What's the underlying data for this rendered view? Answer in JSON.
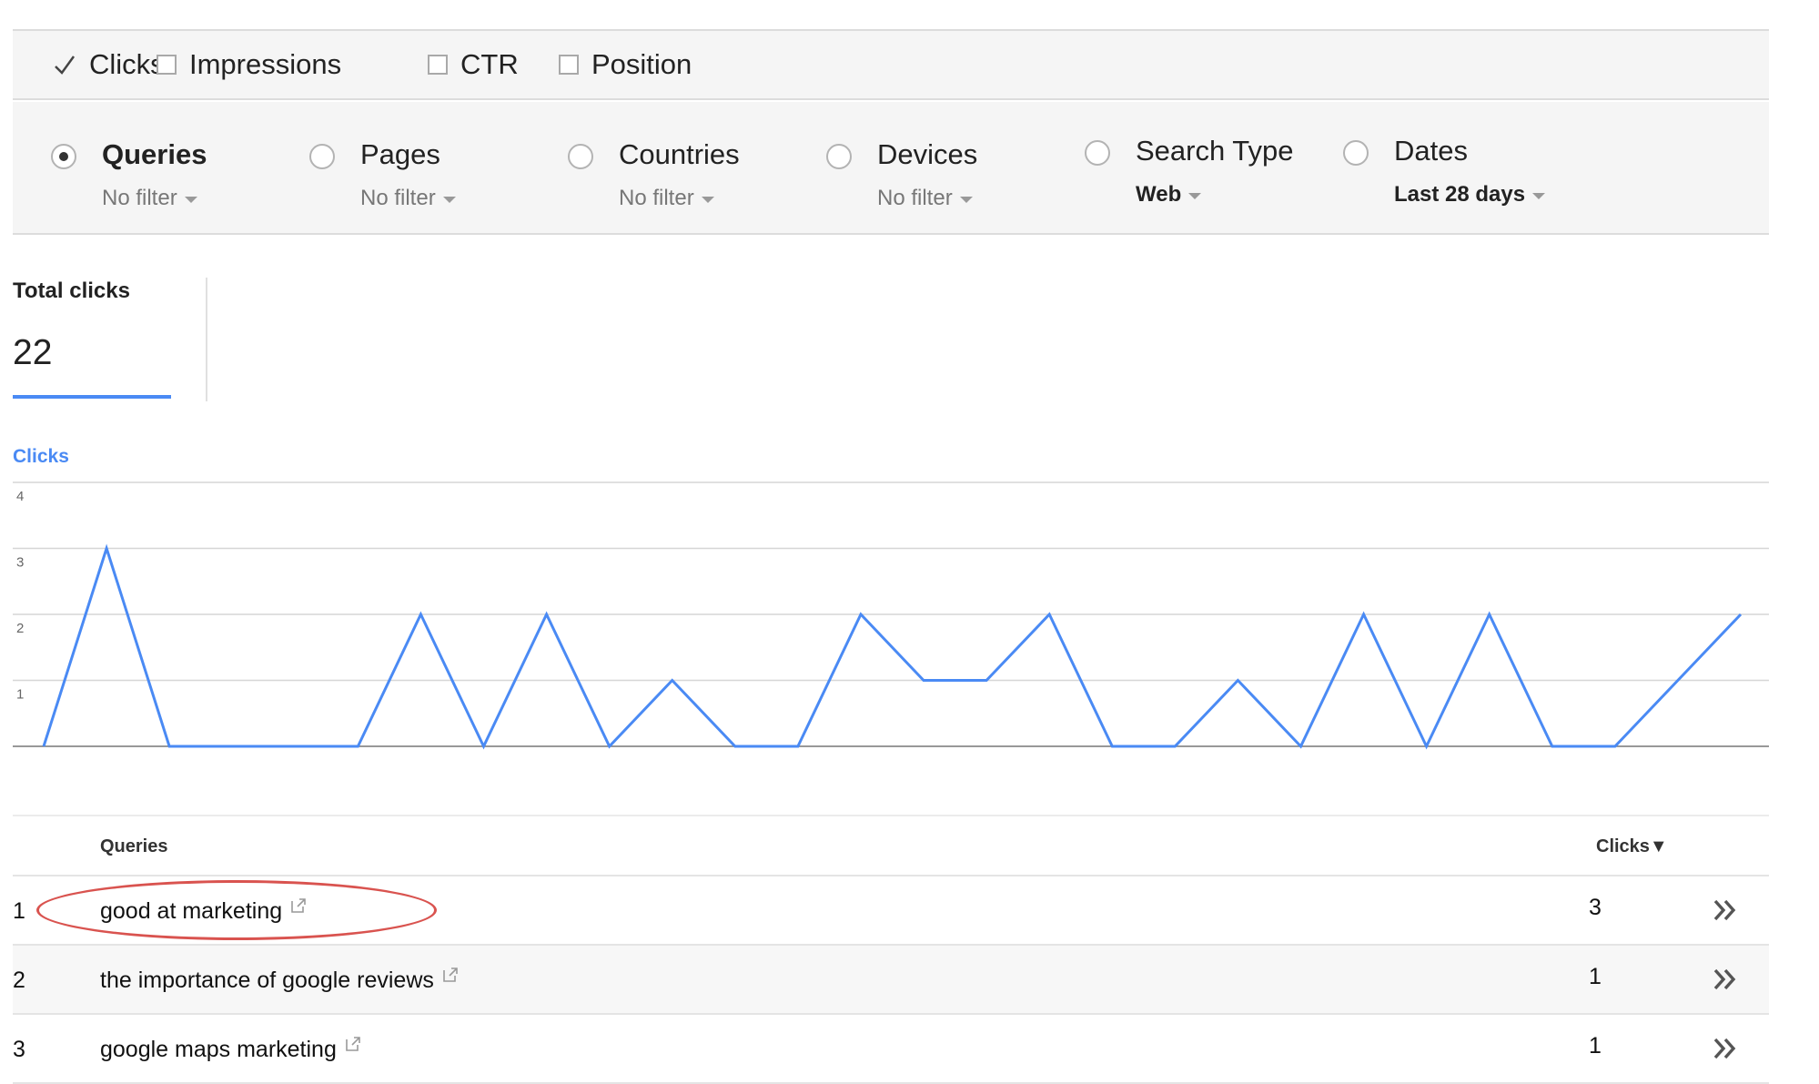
{
  "metrics": [
    {
      "label": "Clicks",
      "checked": true
    },
    {
      "label": "Impressions",
      "checked": false
    },
    {
      "label": "CTR",
      "checked": false
    },
    {
      "label": "Position",
      "checked": false
    }
  ],
  "filters": [
    {
      "label": "Queries",
      "value": "No filter",
      "selected": true
    },
    {
      "label": "Pages",
      "value": "No filter",
      "selected": false
    },
    {
      "label": "Countries",
      "value": "No filter",
      "selected": false
    },
    {
      "label": "Devices",
      "value": "No filter",
      "selected": false
    },
    {
      "label": "Search Type",
      "value": "Web",
      "selected": false
    },
    {
      "label": "Dates",
      "value": "Last 28 days",
      "selected": false
    }
  ],
  "summary": {
    "label": "Total clicks",
    "value": "22"
  },
  "chart_data": {
    "type": "line",
    "title": "Clicks",
    "ylim": [
      0,
      4
    ],
    "yticks": [
      "1",
      "2",
      "3",
      "4"
    ],
    "grid": true,
    "color": "#4a8af4",
    "series": [
      {
        "values": [
          0,
          3,
          0,
          0,
          0,
          0,
          2,
          0,
          2,
          0,
          1,
          0,
          0,
          2,
          1,
          1,
          2,
          0,
          0,
          1,
          0,
          2,
          0,
          2,
          0,
          0,
          1,
          2
        ]
      }
    ]
  },
  "table": {
    "headers": {
      "query": "Queries",
      "clicks": "Clicks▼"
    },
    "rows": [
      {
        "rank": "1",
        "query": "good at marketing",
        "clicks": "3"
      },
      {
        "rank": "2",
        "query": "the importance of google reviews",
        "clicks": "1"
      },
      {
        "rank": "3",
        "query": "google maps marketing",
        "clicks": "1"
      }
    ]
  },
  "colors": {
    "accent": "#4a8af4",
    "highlight": "#d9534f"
  },
  "icons": [
    "check-icon",
    "external-link-icon",
    "double-chevron-right-icon",
    "caret-down-icon"
  ]
}
